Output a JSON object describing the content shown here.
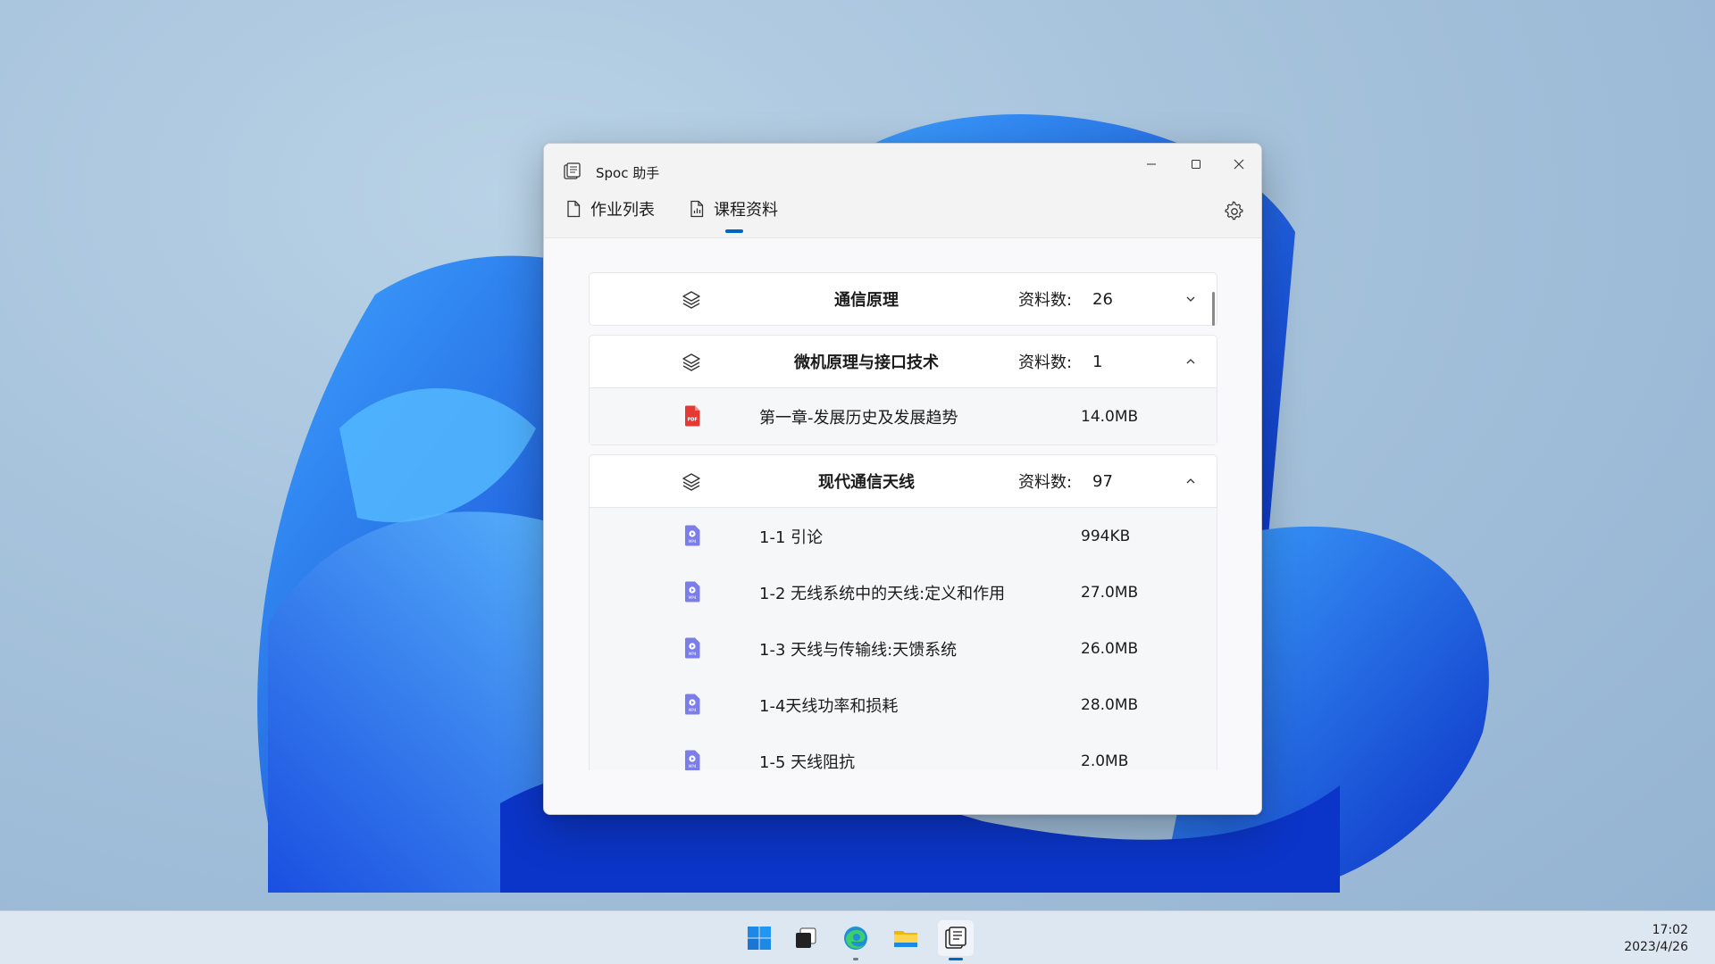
{
  "window": {
    "title": "Spoc 助手",
    "tabs": [
      {
        "label": "作业列表",
        "icon": "document-icon",
        "active": false
      },
      {
        "label": "课程资料",
        "icon": "document-chart-icon",
        "active": true
      }
    ]
  },
  "count_label": "资料数:",
  "sections": [
    {
      "name": "通信原理",
      "count": "26",
      "expanded": false,
      "files": []
    },
    {
      "name": "微机原理与接口技术",
      "count": "1",
      "expanded": true,
      "files": [
        {
          "type": "pdf",
          "name": "第一章-发展历史及发展趋势",
          "size": "14.0MB"
        }
      ]
    },
    {
      "name": "现代通信天线",
      "count": "97",
      "expanded": true,
      "files": [
        {
          "type": "mp4",
          "name": "1-1 引论",
          "size": "994KB"
        },
        {
          "type": "mp4",
          "name": "1-2 无线系统中的天线:定义和作用",
          "size": "27.0MB"
        },
        {
          "type": "mp4",
          "name": "1-3 天线与传输线:天馈系统",
          "size": "26.0MB"
        },
        {
          "type": "mp4",
          "name": "1-4天线功率和损耗",
          "size": "28.0MB"
        },
        {
          "type": "mp4",
          "name": "1-5 天线阻抗",
          "size": "2.0MB"
        }
      ]
    }
  ],
  "taskbar": {
    "apps": [
      "start-icon",
      "task-view-icon",
      "edge-icon",
      "file-explorer-icon",
      "spoc-app-icon"
    ],
    "time": "17:02",
    "date": "2023/4/26"
  },
  "colors": {
    "accent": "#0067c0",
    "pdf": "#e53935",
    "mp4": "#7b7ee8"
  }
}
